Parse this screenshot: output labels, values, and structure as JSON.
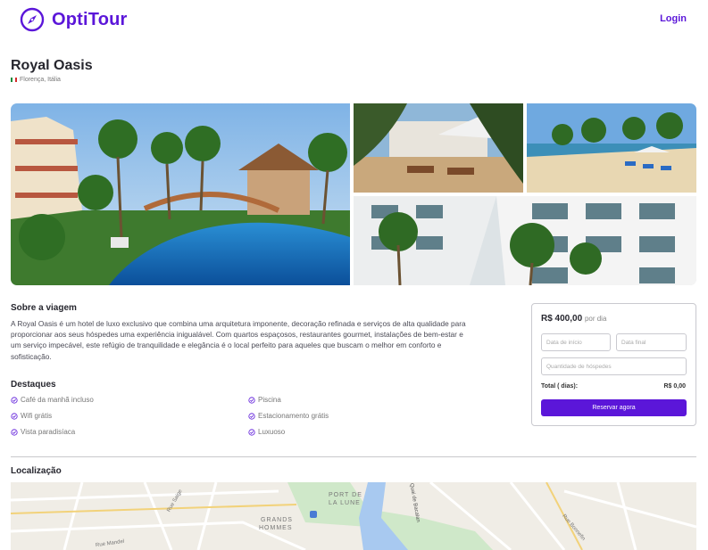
{
  "header": {
    "brand": "OptiTour",
    "login_label": "Login"
  },
  "hotel": {
    "name": "Royal Oasis",
    "location": "Florença, Itália"
  },
  "about": {
    "heading": "Sobre a viagem",
    "text": "A Royal Oasis é um hotel de luxo exclusivo que combina uma arquitetura imponente, decoração refinada e serviços de alta qualidade para proporcionar aos seus hóspedes uma experiência inigualável. Com quartos espaçosos, restaurantes gourmet, instalações de bem-estar e um serviço impecável, este refúgio de tranquilidade e elegância é o local perfeito para aqueles que buscam o melhor em conforto e sofisticação."
  },
  "highlights": {
    "heading": "Destaques",
    "items": [
      "Café da manhã incluso",
      "Piscina",
      "Wifi grátis",
      "Estacionamento grátis",
      "Vista paradisíaca",
      "Luxuoso"
    ]
  },
  "booking": {
    "price": "R$ 400,00",
    "per": "por dia",
    "start_placeholder": "Data de início",
    "end_placeholder": "Data final",
    "guests_placeholder": "Quantidade de hóspedes",
    "total_label": "Total ( dias):",
    "total_value": "R$ 0,00",
    "reserve_label": "Reservar agora"
  },
  "location_section": {
    "heading": "Localização",
    "map_labels": [
      "PORT DE",
      "LA LUNE",
      "GRANDS",
      "HOMMES",
      "Rue Saige",
      "Rue Mandel",
      "Rue Bonnefin",
      "Quai de Bacalan"
    ]
  },
  "colors": {
    "brand": "#5b16d9",
    "text": "#26262e",
    "muted": "#777777"
  },
  "icons": {
    "logo": "compass-icon",
    "flag": "italy-flag-icon",
    "check": "check-circle-icon"
  }
}
